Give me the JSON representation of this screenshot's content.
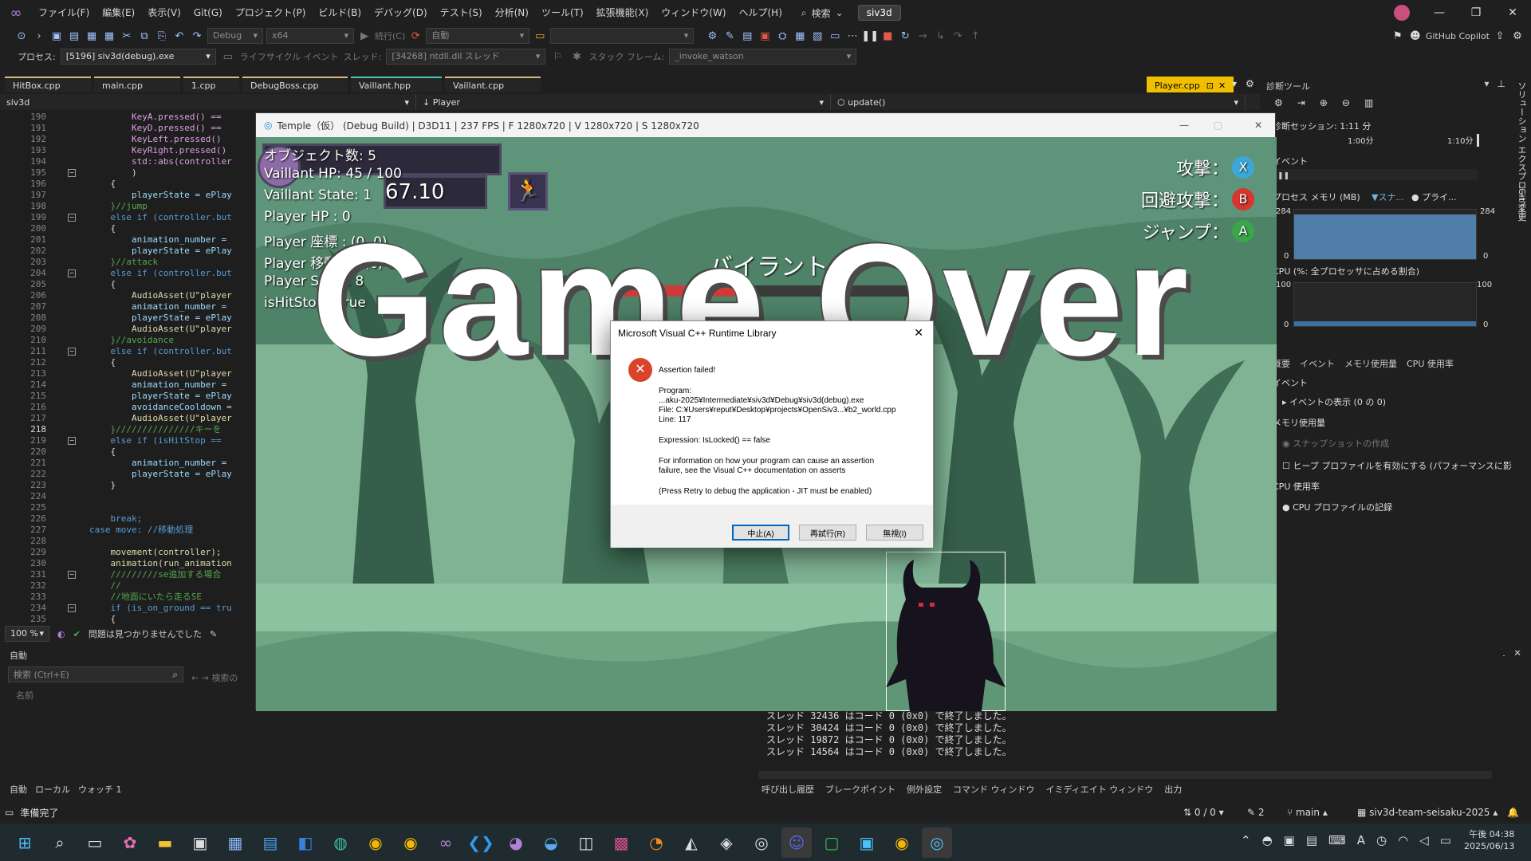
{
  "menubar": {
    "items": [
      "ファイル(F)",
      "編集(E)",
      "表示(V)",
      "Git(G)",
      "プロジェクト(P)",
      "ビルド(B)",
      "デバッグ(D)",
      "テスト(S)",
      "分析(N)",
      "ツール(T)",
      "拡張機能(X)",
      "ウィンドウ(W)",
      "ヘルプ(H)"
    ],
    "search_label": "検索",
    "solution_name": "siv3d"
  },
  "toolbar": {
    "config": "Debug",
    "platform": "x64",
    "continue_label": "続行(C)",
    "auto_label": "自動",
    "copilot_label": "GitHub Copilot",
    "process_label": "プロセス:",
    "process_value": "[5196] siv3d(debug).exe",
    "lifecycle_label": "ライフサイクル イベント",
    "thread_label": "スレッド:",
    "thread_value": "[34268] ntdll.dll スレッド",
    "stackframe_label": "スタック フレーム:",
    "stackframe_value": "_invoke_watson"
  },
  "tabs": [
    "HitBox.cpp",
    "main.cpp",
    "1.cpp",
    "DebugBoss.cpp",
    "Vaillant.hpp",
    "Vaillant.cpp"
  ],
  "active_tab": "Player.cpp",
  "navbar": {
    "project": "siv3d",
    "scope": "Player",
    "member": "update()"
  },
  "editor": {
    "line_numbers": [
      "190",
      "191",
      "192",
      "193",
      "194",
      "195",
      "196",
      "197",
      "198",
      "199",
      "200",
      "201",
      "202",
      "203",
      "204",
      "205",
      "206",
      "207",
      "208",
      "209",
      "210",
      "211",
      "212",
      "213",
      "214",
      "215",
      "216",
      "217",
      "218",
      "219",
      "220",
      "221",
      "222",
      "223",
      "224",
      "225",
      "226",
      "227",
      "228",
      "229",
      "230",
      "231",
      "232",
      "233",
      "234",
      "235"
    ],
    "lines": [
      "        KeyA.pressed() ==",
      "        KeyD.pressed() ==",
      "        KeyLeft.pressed()",
      "        KeyRight.pressed()",
      "        std::abs(controller",
      "        )",
      "    {",
      "        playerState = ePlay",
      "    }//jump",
      "    else if (controller.but",
      "    {",
      "        animation_number =",
      "        playerState = ePlay",
      "    }//attack",
      "    else if (controller.but",
      "    {",
      "        AudioAsset(U\"player",
      "        animation_number =",
      "        playerState = ePlay",
      "        AudioAsset(U\"player",
      "    }//avoidance",
      "    else if (controller.but",
      "    {",
      "        AudioAsset(U\"player",
      "        animation_number =",
      "        playerState = ePlay",
      "        avoidanceCooldown =",
      "        AudioAsset(U\"player",
      "    }///////////////キーを",
      "    else if (isHitStop ==",
      "    {",
      "        animation_number =",
      "        playerState = ePlay",
      "    }",
      "",
      "",
      "    break;",
      "case move: //移動処理",
      "",
      "    movement(controller);",
      "    animation(run_animation",
      "    /////////se追加する場合",
      "    //",
      "    //地面にいたら走るSE",
      "    if (is_on_ground == tru",
      "    {"
    ],
    "zoom": "100 %",
    "issues": "問題は見つかりませんでした"
  },
  "autos": {
    "title": "自動",
    "search_placeholder": "検索 (Ctrl+E)",
    "search_depth": "検索の",
    "col_name": "名前"
  },
  "bottom_left_tabs": [
    "自動",
    "ローカル",
    "ウォッチ 1"
  ],
  "game": {
    "window_title": "Temple（仮） (Debug Build) | D3D11 | 237 FPS | F 1280x720 | V 1280x720 | S 1280x720",
    "hud": [
      "オブジェクト数: 5",
      "Vaillant HP: 45 / 100",
      "Vaillant State: 1",
      "Player HP : 0",
      "Player 座標 : (0, 0)",
      "Player 移動量 : (0, 0)",
      "Player State: 8",
      "isHitStop : true"
    ],
    "timer": "67.10",
    "controls": [
      {
        "label": "攻撃：",
        "button": "X",
        "color": "#3ba7d8"
      },
      {
        "label": "回避攻撃：",
        "button": "B",
        "color": "#d8352e"
      },
      {
        "label": "ジャンプ：",
        "button": "A",
        "color": "#3aa54a"
      }
    ],
    "boss_name": "バイラント",
    "boss_hp_fraction": 0.45,
    "game_over": "Game Over"
  },
  "dialog": {
    "title": "Microsoft Visual C++ Runtime Library",
    "assert": "Assertion failed!",
    "program_label": "Program:",
    "program": "...aku-2025¥Intermediate¥siv3d¥Debug¥siv3d(debug).exe",
    "file": "File: C:¥Users¥reput¥Desktop¥projects¥OpenSiv3...¥b2_world.cpp",
    "line": "Line: 117",
    "expression": "Expression: IsLocked() == false",
    "info1": "For information on how your program can cause an assertion",
    "info2": "failure, see the Visual C++ documentation on asserts",
    "retry_note": "(Press Retry to debug the application - JIT must be enabled)",
    "buttons": [
      "中止(A)",
      "再試行(R)",
      "無視(I)"
    ]
  },
  "diag": {
    "title": "診断ツール",
    "session": "診断セッション: 1:11 分",
    "t1": "1:00分",
    "t2": "1:10分",
    "events_hdr": "イベント",
    "mem_hdr": "プロセス メモリ (MB)",
    "legend1": "スナ...",
    "legend2": "プライ...",
    "mem_max": "284",
    "mem_min": "0",
    "cpu_hdr": "CPU (%: 全プロセッサに占める割合)",
    "cpu_max": "100",
    "cpu_min": "0",
    "tabs": [
      "概要",
      "イベント",
      "メモリ使用量",
      "CPU 使用率"
    ],
    "ev_title": "イベント",
    "ev_item": "イベントの表示 (0 の 0)",
    "mem_title": "メモリ使用量",
    "snapshot": "スナップショットの作成",
    "heap": "ヒープ プロファイルを有効にする (パフォーマンスに影響しま",
    "cpu_title": "CPU 使用率",
    "cpu_rec": "CPU プロファイルの記録"
  },
  "side_labels": [
    "ソリューション エクスプローラー",
    "Git 変更"
  ],
  "output": {
    "lines": [
      "スレッド 32436 はコード 0 (0x0) で終了しました。",
      "スレッド 30424 はコード 0 (0x0) で終了しました。",
      "スレッド 19872 はコード 0 (0x0) で終了しました。",
      "スレッド 14564 はコード 0 (0x0) で終了しました。"
    ],
    "tabs": [
      "呼び出し履歴",
      "ブレークポイント",
      "例外設定",
      "コマンド ウィンドウ",
      "イミディエイト ウィンドウ",
      "出力"
    ]
  },
  "status": {
    "ready": "準備完了",
    "updown": "0 / 0",
    "pencil": "2",
    "branch": "main",
    "repo": "siv3d-team-seisaku-2025",
    "time": "午後 04:38",
    "date": "2025/06/13"
  }
}
